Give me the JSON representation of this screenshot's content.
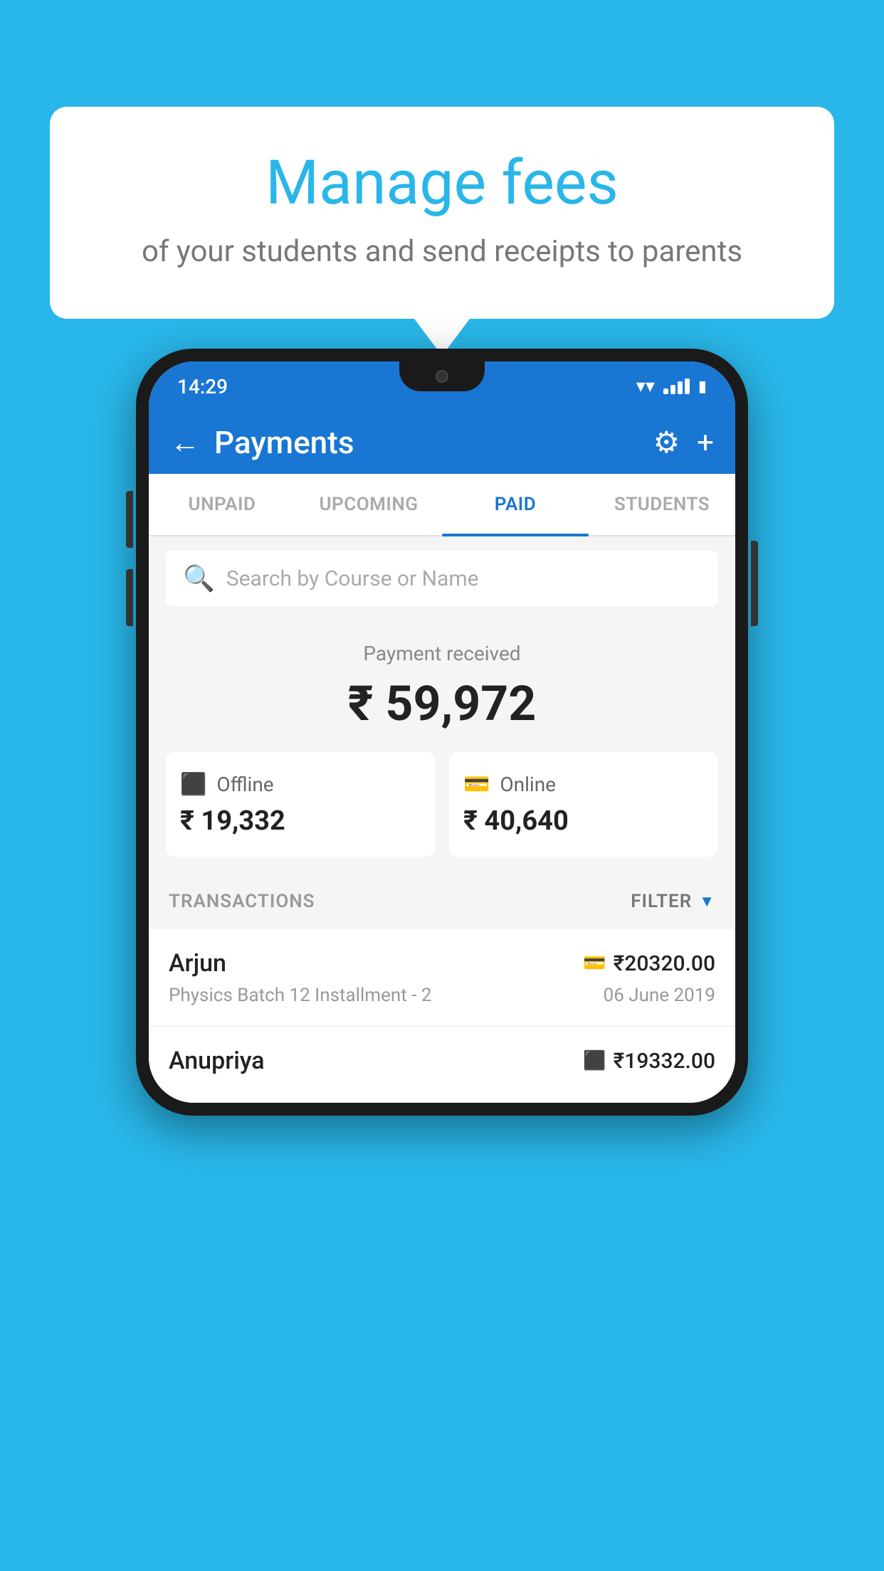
{
  "page": {
    "background_color": "#29b6e8"
  },
  "speech_bubble": {
    "title": "Manage fees",
    "subtitle": "of your students and send receipts to parents"
  },
  "status_bar": {
    "time": "14:29"
  },
  "app_header": {
    "title": "Payments",
    "back_label": "←",
    "settings_label": "⚙",
    "add_label": "+"
  },
  "tabs": [
    {
      "label": "UNPAID",
      "active": false
    },
    {
      "label": "UPCOMING",
      "active": false
    },
    {
      "label": "PAID",
      "active": true
    },
    {
      "label": "STUDENTS",
      "active": false
    }
  ],
  "search": {
    "placeholder": "Search by Course or Name"
  },
  "payment_summary": {
    "received_label": "Payment received",
    "total_amount": "₹ 59,972",
    "offline_label": "Offline",
    "offline_amount": "₹ 19,332",
    "online_label": "Online",
    "online_amount": "₹ 40,640"
  },
  "transactions_section": {
    "label": "TRANSACTIONS",
    "filter_label": "FILTER"
  },
  "transactions": [
    {
      "name": "Arjun",
      "amount": "₹20320.00",
      "payment_type": "online",
      "course": "Physics Batch 12 Installment - 2",
      "date": "06 June 2019"
    },
    {
      "name": "Anupriya",
      "amount": "₹19332.00",
      "payment_type": "offline",
      "course": "",
      "date": ""
    }
  ]
}
